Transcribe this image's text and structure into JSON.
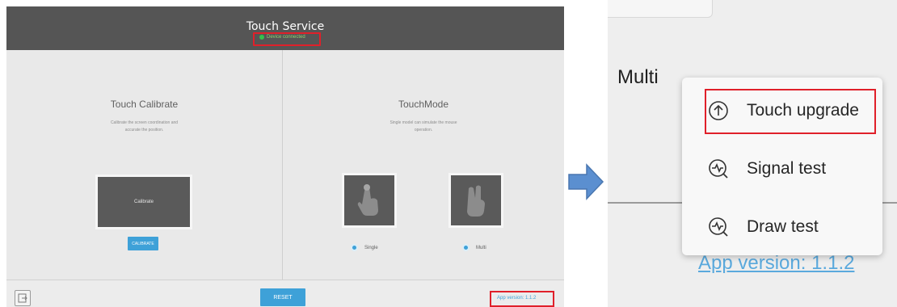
{
  "app": {
    "title": "Touch Service",
    "status": "Device connected",
    "status_color": "#35c24a",
    "calibrate_pane": {
      "title": "Touch Calibrate",
      "desc_line1": "Calibrate the screen coordination and",
      "desc_line2": "accurate the position.",
      "tile_label": "Calibrate",
      "button_label": "CALIBRATE"
    },
    "mode_pane": {
      "title": "TouchMode",
      "desc_line1": "Single model can simulate the mouse",
      "desc_line2": "operation.",
      "options": [
        {
          "label": "Single",
          "icon": "single-finger-touch-icon"
        },
        {
          "label": "Multi",
          "icon": "multi-finger-touch-icon"
        }
      ]
    },
    "footer": {
      "exit_icon": "exit-icon",
      "reset_label": "RESET",
      "version": "App version: 1.1.2"
    },
    "accent_color": "#3ea1d8",
    "highlight_color": "#e0202a"
  },
  "zoom": {
    "multi_label": "Multi",
    "version": "App version: 1.1.2",
    "menu": [
      {
        "label": "Touch upgrade",
        "icon": "upgrade-icon"
      },
      {
        "label": "Signal test",
        "icon": "signal-test-icon"
      },
      {
        "label": "Draw test",
        "icon": "draw-test-icon"
      }
    ]
  }
}
